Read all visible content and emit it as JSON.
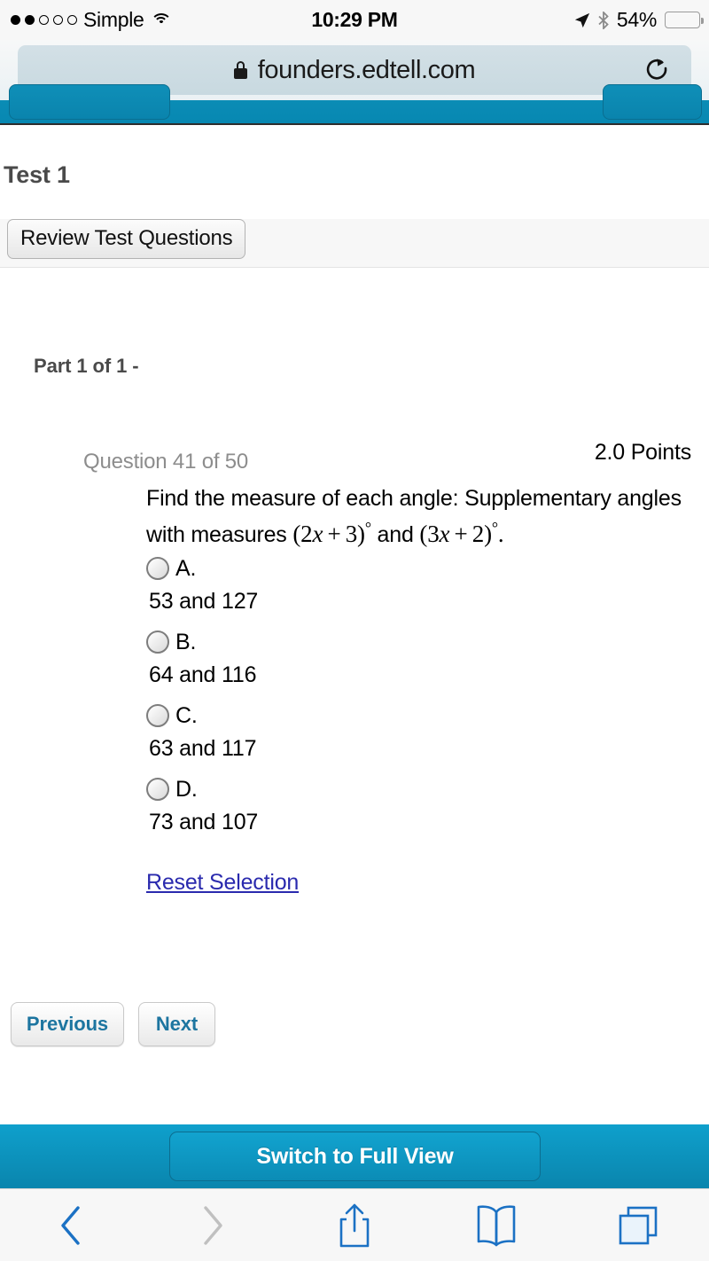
{
  "status_bar": {
    "carrier": "Simple",
    "signal_dots_filled": 2,
    "signal_dots_total": 5,
    "wifi_icon": "wifi-icon",
    "time": "10:29 PM",
    "location_icon": "location-arrow-icon",
    "bluetooth_icon": "bluetooth-icon",
    "battery_percent": "54%",
    "battery_level": 54,
    "battery_color": "#f9ca0a"
  },
  "browser": {
    "lock_icon": "lock-icon",
    "url": "founders.edtell.com",
    "reload_icon": "reload-icon",
    "toolbar": {
      "back": "back-chevron-icon",
      "forward": "forward-chevron-icon",
      "share": "share-icon",
      "bookmarks": "book-icon",
      "tabs": "tabs-icon",
      "back_enabled": true,
      "forward_enabled": false,
      "active_color": "#1b71c4",
      "disabled_color": "#bcbcbc"
    }
  },
  "app_bar": {
    "accent_color": "#0888b2"
  },
  "page": {
    "test_title": "Test 1",
    "review_button": "Review Test Questions",
    "part_label": "Part 1 of 1 -"
  },
  "question": {
    "number_label": "Question 41 of 50",
    "points_label": "2.0 Points",
    "prompt_line1": "Find the measure of each angle: Supplementary angles",
    "prompt_line2_prefix": "with measures ",
    "expr1": {
      "coef": "2",
      "var": "x",
      "op": "+",
      "const": "3"
    },
    "expr2": {
      "coef": "3",
      "var": "x",
      "op": "+",
      "const": "2"
    },
    "conjunction": " and ",
    "degree": "°",
    "period": ".",
    "choices": [
      {
        "letter": "A.",
        "text": "53 and 127",
        "selected": false
      },
      {
        "letter": "B.",
        "text": "64 and 116",
        "selected": false
      },
      {
        "letter": "C.",
        "text": "63 and 117",
        "selected": false
      },
      {
        "letter": "D.",
        "text": "73 and 107",
        "selected": false
      }
    ],
    "reset_link": "Reset Selection"
  },
  "navigation": {
    "previous": "Previous",
    "next": "Next",
    "link_color": "#1d75a0"
  },
  "footer": {
    "full_view_button": "Switch to Full View",
    "background_color": "#0a8cb4"
  }
}
